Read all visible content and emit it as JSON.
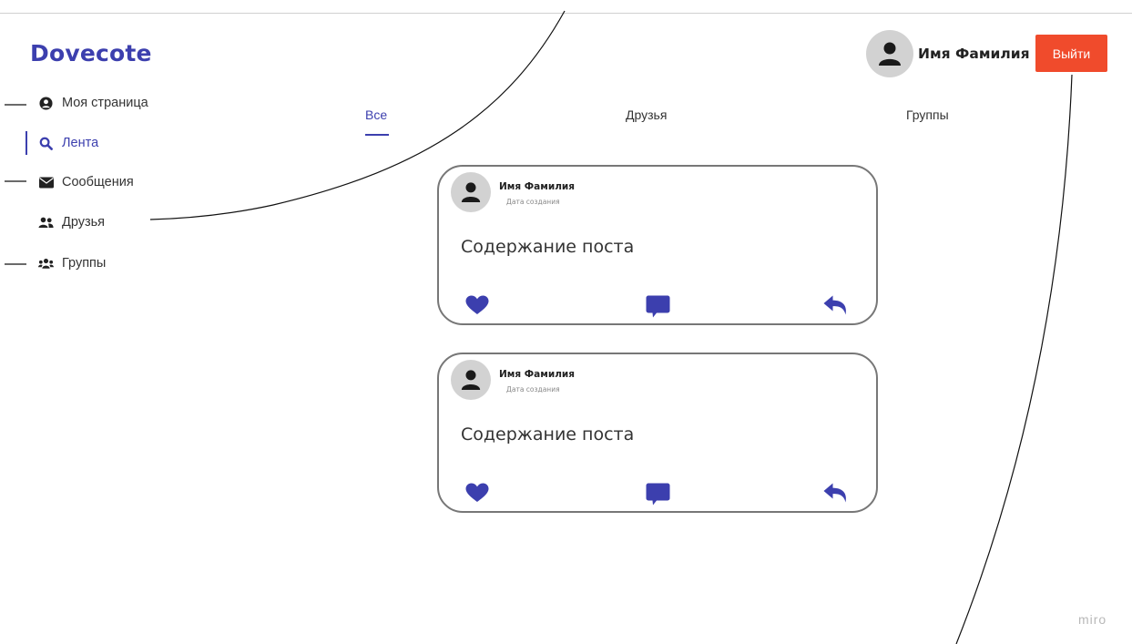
{
  "app": {
    "logo": "Dovecote"
  },
  "sidebar": {
    "items": [
      {
        "label": "Моя страница",
        "icon": "user-circle-icon"
      },
      {
        "label": "Лента",
        "icon": "search-icon",
        "active": true
      },
      {
        "label": "Сообщения",
        "icon": "envelope-icon"
      },
      {
        "label": "Друзья",
        "icon": "user-friends-icon"
      },
      {
        "label": "Группы",
        "icon": "users-group-icon"
      }
    ]
  },
  "tabs": [
    {
      "label": "Все",
      "active": true
    },
    {
      "label": "Друзья"
    },
    {
      "label": "Группы"
    }
  ],
  "header": {
    "user_name": "Имя Фамилия",
    "logout_label": "Выйти"
  },
  "posts": [
    {
      "author": "Имя Фамилия",
      "date": "Дата создания",
      "content": "Содержание поста"
    },
    {
      "author": "Имя Фамилия",
      "date": "Дата создания",
      "content": "Содержание поста"
    }
  ],
  "watermark": "miro",
  "colors": {
    "accent": "#3c3fae",
    "logout": "#f04b2c",
    "avatar_bg": "#d2d2d2"
  }
}
